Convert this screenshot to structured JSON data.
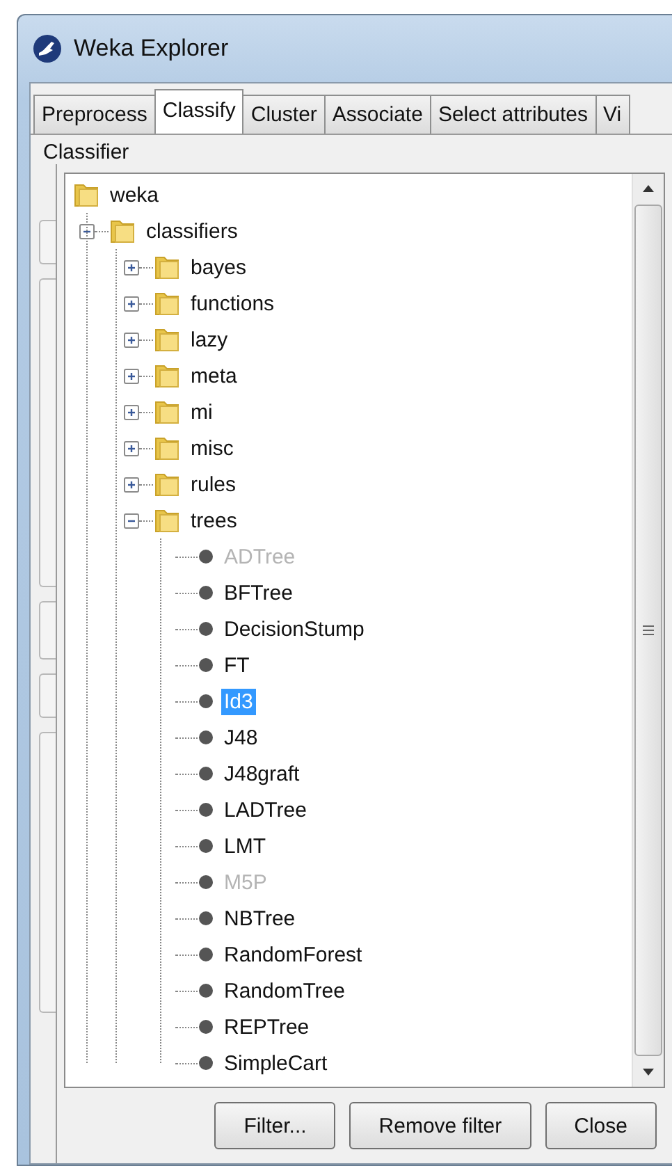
{
  "window": {
    "title": "Weka Explorer"
  },
  "tabs": [
    {
      "label": "Preprocess",
      "selected": false
    },
    {
      "label": "Classify",
      "selected": true
    },
    {
      "label": "Cluster",
      "selected": false
    },
    {
      "label": "Associate",
      "selected": false
    },
    {
      "label": "Select attributes",
      "selected": false
    },
    {
      "label": "Vi",
      "selected": false
    }
  ],
  "group_label": "Classifier",
  "tree": [
    {
      "label": "weka",
      "kind": "folder",
      "selected": false,
      "children": [
        {
          "label": "classifiers",
          "kind": "folder",
          "selected": false,
          "expanded": true,
          "children": [
            {
              "label": "bayes",
              "kind": "folder",
              "selected": false,
              "expanded": false
            },
            {
              "label": "functions",
              "kind": "folder",
              "selected": false,
              "expanded": false
            },
            {
              "label": "lazy",
              "kind": "folder",
              "selected": false,
              "expanded": false
            },
            {
              "label": "meta",
              "kind": "folder",
              "selected": false,
              "expanded": false
            },
            {
              "label": "mi",
              "kind": "folder",
              "selected": false,
              "expanded": false
            },
            {
              "label": "misc",
              "kind": "folder",
              "selected": false,
              "expanded": false
            },
            {
              "label": "rules",
              "kind": "folder",
              "selected": false,
              "expanded": false
            },
            {
              "label": "trees",
              "kind": "folder",
              "selected": false,
              "expanded": true,
              "children": [
                {
                  "label": "ADTree",
                  "kind": "leaf",
                  "selected": false,
                  "disabled": true
                },
                {
                  "label": "BFTree",
                  "kind": "leaf",
                  "selected": false,
                  "disabled": false
                },
                {
                  "label": "DecisionStump",
                  "kind": "leaf",
                  "selected": false,
                  "disabled": false
                },
                {
                  "label": "FT",
                  "kind": "leaf",
                  "selected": false,
                  "disabled": false
                },
                {
                  "label": "Id3",
                  "kind": "leaf",
                  "selected": true,
                  "disabled": false
                },
                {
                  "label": "J48",
                  "kind": "leaf",
                  "selected": false,
                  "disabled": false
                },
                {
                  "label": "J48graft",
                  "kind": "leaf",
                  "selected": false,
                  "disabled": false
                },
                {
                  "label": "LADTree",
                  "kind": "leaf",
                  "selected": false,
                  "disabled": false
                },
                {
                  "label": "LMT",
                  "kind": "leaf",
                  "selected": false,
                  "disabled": false
                },
                {
                  "label": "M5P",
                  "kind": "leaf",
                  "selected": false,
                  "disabled": true
                },
                {
                  "label": "NBTree",
                  "kind": "leaf",
                  "selected": false,
                  "disabled": false
                },
                {
                  "label": "RandomForest",
                  "kind": "leaf",
                  "selected": false,
                  "disabled": false
                },
                {
                  "label": "RandomTree",
                  "kind": "leaf",
                  "selected": false,
                  "disabled": false
                },
                {
                  "label": "REPTree",
                  "kind": "leaf",
                  "selected": false,
                  "disabled": false
                },
                {
                  "label": "SimpleCart",
                  "kind": "leaf",
                  "selected": false,
                  "disabled": false
                }
              ]
            }
          ]
        }
      ]
    }
  ],
  "buttons": [
    "Filter...",
    "Remove filter",
    "Close"
  ]
}
